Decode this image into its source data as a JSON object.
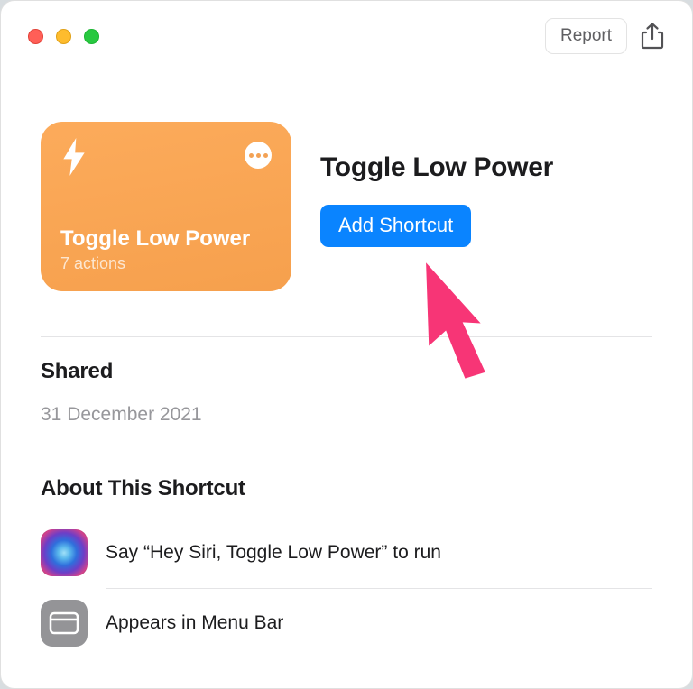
{
  "titlebar": {
    "report_label": "Report"
  },
  "shortcut": {
    "title": "Toggle Low Power",
    "subtitle": "7 actions"
  },
  "hero": {
    "title": "Toggle Low Power",
    "add_button_label": "Add Shortcut"
  },
  "shared": {
    "heading": "Shared",
    "date": "31 December 2021"
  },
  "about": {
    "heading": "About This Shortcut",
    "rows": [
      {
        "text": "Say “Hey Siri, Toggle Low Power” to run"
      },
      {
        "text": "Appears in Menu Bar"
      }
    ]
  },
  "colors": {
    "accent": "#0a84ff",
    "tile_start": "#fcab5b",
    "tile_end": "#f6a04d"
  }
}
